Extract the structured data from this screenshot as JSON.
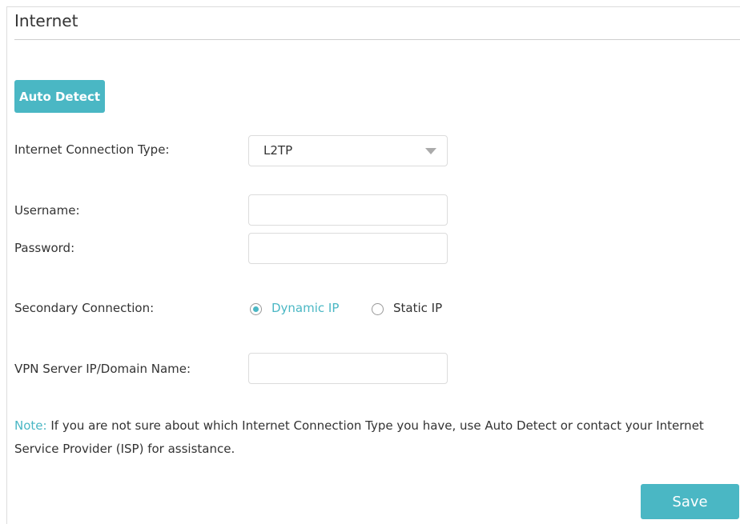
{
  "page": {
    "title": "Internet"
  },
  "buttons": {
    "auto_detect": "Auto Detect",
    "save": "Save"
  },
  "fields": {
    "connection_type": {
      "label": "Internet Connection Type:",
      "value": "L2TP"
    },
    "username": {
      "label": "Username:",
      "value": ""
    },
    "password": {
      "label": "Password:",
      "value": ""
    },
    "secondary_connection": {
      "label": "Secondary Connection:",
      "options": [
        {
          "label": "Dynamic IP",
          "selected": true
        },
        {
          "label": "Static IP",
          "selected": false
        }
      ]
    },
    "vpn_server": {
      "label": "VPN Server IP/Domain Name:",
      "value": ""
    }
  },
  "note": {
    "prefix": "Note:",
    "text": "If you are not sure about which Internet Connection Type you have, use Auto Detect or contact your Internet Service Provider (ISP) for assistance."
  },
  "colors": {
    "accent": "#4ab7c4",
    "text": "#333333",
    "border": "#dcdcdc"
  }
}
